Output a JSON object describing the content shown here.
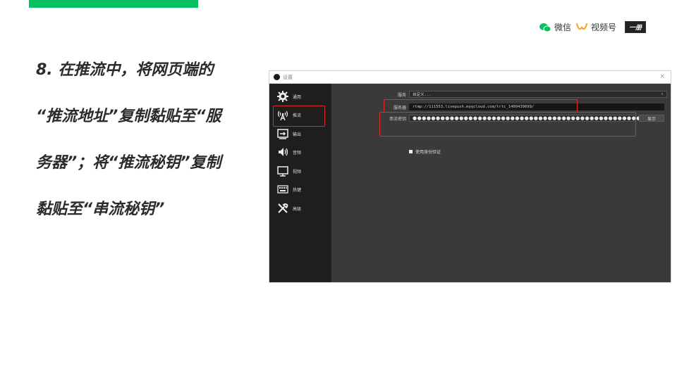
{
  "brand": {
    "wechat_label": "微信",
    "channels_label": "视频号",
    "logo_text": "一册"
  },
  "instruction": {
    "lines": [
      "8. 在推流中，将网页端的",
      "“推流地址”复制黏贴至“服",
      "务器”；将“推流秘钥”复制",
      "黏贴至“串流秘钥”"
    ]
  },
  "window": {
    "title": "设置",
    "close_glyph": "×",
    "sidebar": [
      {
        "label": "通用",
        "icon": "gear-icon"
      },
      {
        "label": "推流",
        "icon": "broadcast-icon"
      },
      {
        "label": "输出",
        "icon": "output-icon"
      },
      {
        "label": "音频",
        "icon": "speaker-icon"
      },
      {
        "label": "视频",
        "icon": "monitor-icon"
      },
      {
        "label": "热键",
        "icon": "keyboard-icon"
      },
      {
        "label": "高级",
        "icon": "tools-icon"
      }
    ],
    "service_label": "服务",
    "service_value": "自定义...",
    "server_label": "服务器",
    "server_value": "rtmp://111553.livepush.myqcloud.com/trtc_1400439699/",
    "stream_key_label": "串流密钥",
    "stream_key_value": "●●●●●●●●●●●●●●●●●●●●●●●●●●●●●●●●●●●●●●●●●●●●●●●●●●",
    "show_button": "显示",
    "auth_checkbox_label": "使用身份验证"
  },
  "colors": {
    "accent": "#07c160",
    "highlight": "#e52a2a"
  }
}
